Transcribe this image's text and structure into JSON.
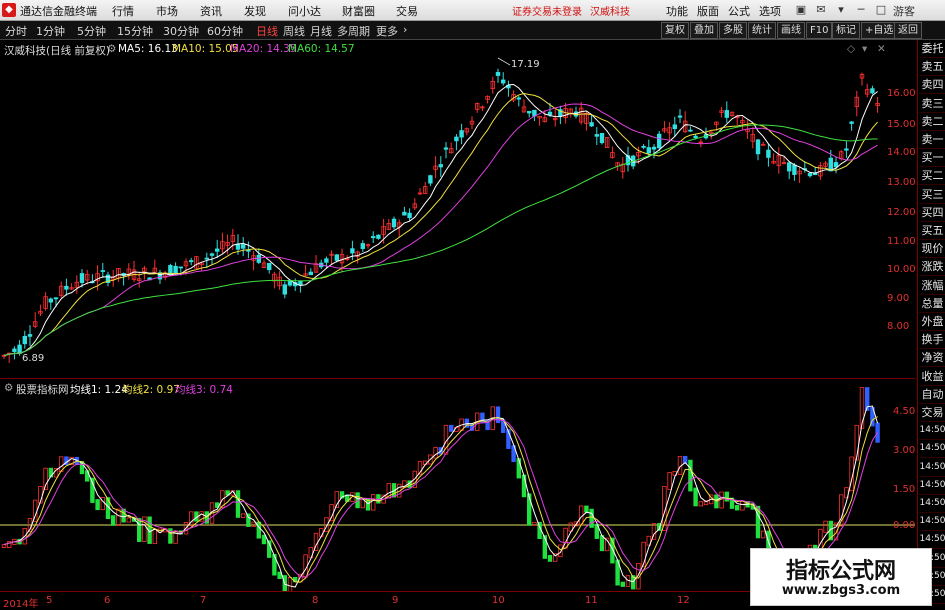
{
  "menubar": {
    "app_title": "通达信金融终端",
    "items": [
      "行情",
      "市场",
      "资讯",
      "发现",
      "问小达",
      "财富圈",
      "交易"
    ],
    "notice_trade": "证券交易未登录",
    "notice_stock": "汉威科技",
    "right_items": [
      "功能",
      "版面",
      "公式",
      "选项"
    ],
    "guest": "游客"
  },
  "toolbar": {
    "periods": [
      "分时",
      "1分钟",
      "5分钟",
      "15分钟",
      "30分钟",
      "60分钟",
      "日线",
      "周线",
      "月线",
      "多周期",
      "更多"
    ],
    "active_period": "日线",
    "right_buttons": [
      "复权",
      "叠加",
      "多股",
      "统计",
      "画线",
      "F10",
      "标记",
      "+自选",
      "返回"
    ]
  },
  "main_chart": {
    "stock_label": "汉威科技(日线 前复权)",
    "ma_labels": [
      {
        "text": "MA5: 16.13",
        "color": "#ffffff"
      },
      {
        "text": "MA10: 15.05",
        "color": "#f0e040"
      },
      {
        "text": "MA20: 14.35",
        "color": "#e040e0"
      },
      {
        "text": "MA60: 14.57",
        "color": "#40e040"
      }
    ],
    "high_annotation": "17.19",
    "low_annotation": "6.89",
    "y_ticks": [
      "16.00",
      "15.00",
      "14.00",
      "13.00",
      "12.00",
      "11.00",
      "10.00",
      "9.00",
      "8.00"
    ]
  },
  "sub_chart": {
    "indicator_label": "股票指标网",
    "lines": [
      {
        "text": "均线1: 1.24",
        "color": "#ffffff"
      },
      {
        "text": "均线2: 0.97",
        "color": "#f0e040"
      },
      {
        "text": "均线3: 0.74",
        "color": "#e040e0"
      }
    ],
    "y_ticks": [
      "4.50",
      "3.00",
      "1.50",
      "0.00"
    ]
  },
  "sidelist": {
    "items": [
      "委托",
      "卖五",
      "卖四",
      "卖三",
      "卖二",
      "卖一",
      "买一",
      "买二",
      "买三",
      "买四",
      "买五",
      "现价",
      "涨跌",
      "涨幅",
      "总量",
      "外盘",
      "换手",
      "净资",
      "收益"
    ],
    "items_lower": [
      "自动",
      "交易",
      "14:50",
      "14:50",
      "14:50",
      "14:50",
      "14:50",
      "14:50",
      "14:50",
      "14:50",
      "14:50",
      "14:50"
    ]
  },
  "xaxis": {
    "labels": [
      "2014年",
      "5",
      "6",
      "7",
      "8",
      "9",
      "10",
      "11",
      "12"
    ]
  },
  "watermark": {
    "title": "指标公式网",
    "url": "www.zbgs3.com"
  },
  "colors": {
    "up": "#ff3030",
    "down": "#30e0e0",
    "ma5": "#ffffff",
    "ma10": "#f0e040",
    "ma20": "#e040e0",
    "ma60": "#40e040"
  }
}
